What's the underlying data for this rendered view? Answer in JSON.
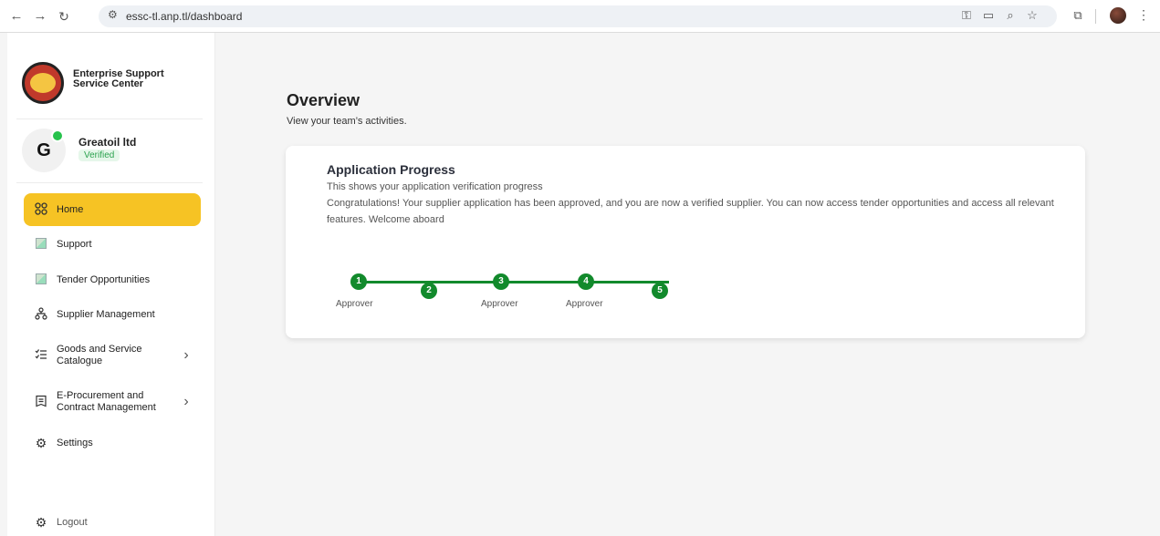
{
  "browser": {
    "url": "essc-tl.anp.tl/dashboard",
    "back_icon": "←",
    "forward_icon": "→",
    "reload_icon": "↻"
  },
  "sidebar": {
    "org_name": "Enterprise Support Service Center",
    "avatar_letter": "G",
    "company": "Greatoil ltd",
    "status": "Verified",
    "items": [
      {
        "label": "Home",
        "icon": "grid-icon"
      },
      {
        "label": "Support",
        "icon": "broken-image-icon"
      },
      {
        "label": "Tender Opportunities",
        "icon": "broken-image-icon"
      },
      {
        "label": "Supplier Management",
        "icon": "network-icon"
      },
      {
        "label": "Goods and Service Catalogue",
        "icon": "list-check-icon"
      },
      {
        "label": "E-Procurement and Contract Management",
        "icon": "receipt-icon"
      },
      {
        "label": "Settings",
        "icon": "gear-icon"
      }
    ],
    "logout": "Logout"
  },
  "main": {
    "title": "Overview",
    "subtitle": "View your team’s activities.",
    "card": {
      "title": "Application Progress",
      "subtitle": "This shows your application verification progress",
      "message": "Congratulations! Your supplier application has been approved, and you are now a verified supplier. You can now access tender opportunities and access all relevant features. Welcome aboard"
    },
    "steps": [
      {
        "number": "1",
        "label": "Approver"
      },
      {
        "number": "2",
        "label": ""
      },
      {
        "number": "3",
        "label": "Approver"
      },
      {
        "number": "4",
        "label": "Approver"
      },
      {
        "number": "5",
        "label": ""
      }
    ]
  },
  "colors": {
    "accent": "#f6c324",
    "progress": "#128a2c",
    "verified": "#2ca24f"
  }
}
